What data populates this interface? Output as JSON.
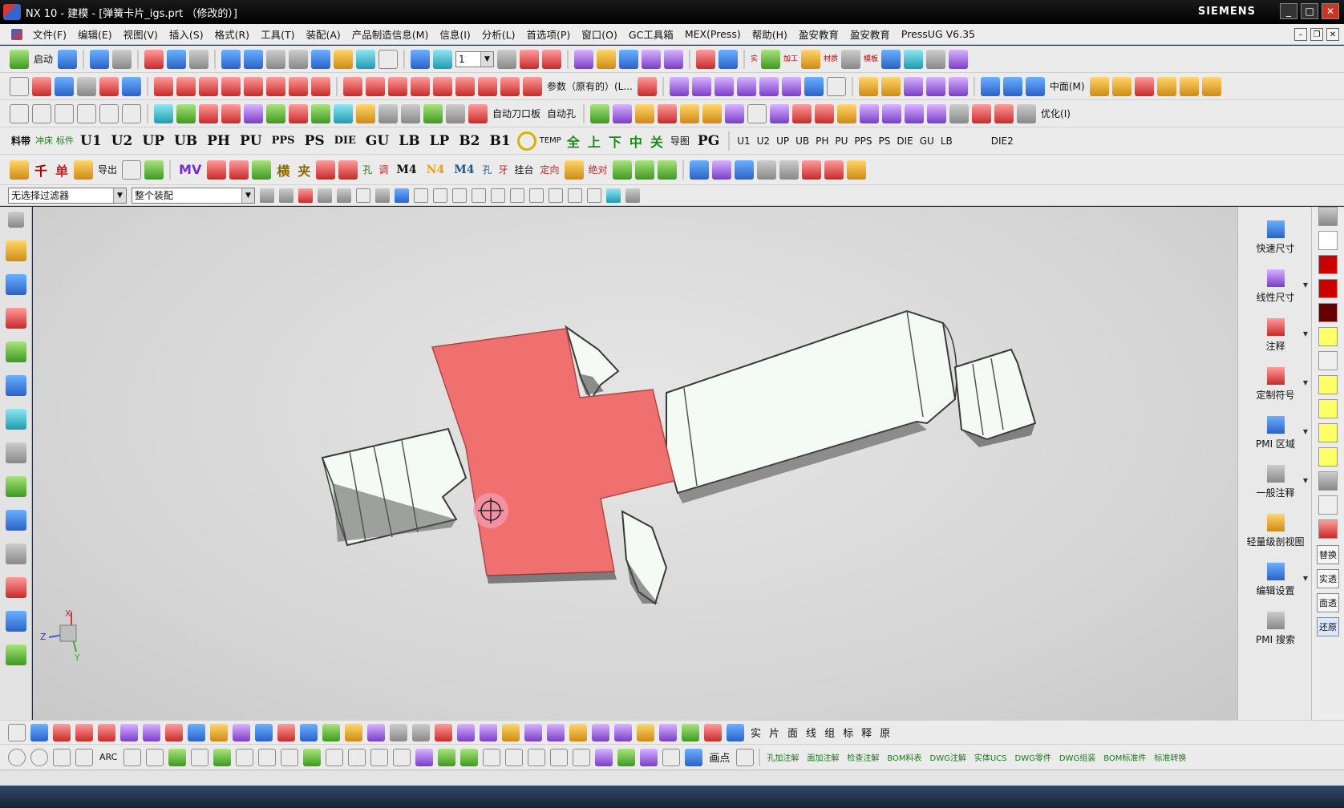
{
  "window": {
    "title": "NX 10 - 建模 - [弹簧卡片_igs.prt （修改的）]",
    "brand": "SIEMENS",
    "controls": [
      "_",
      "□",
      "✕"
    ]
  },
  "menu": [
    "文件(F)",
    "编辑(E)",
    "视图(V)",
    "插入(S)",
    "格式(R)",
    "工具(T)",
    "装配(A)",
    "产品制造信息(M)",
    "信息(I)",
    "分析(L)",
    "首选项(P)",
    "窗口(O)",
    "GC工具箱",
    "MEX(Press)",
    "帮助(H)",
    "盈安教育",
    "盈安教育",
    "PressUG V6.35"
  ],
  "toolbar1": {
    "start": "启动",
    "layer_value": "1",
    "right_labels": [
      "实",
      "加工",
      "材质",
      "模板"
    ]
  },
  "toolbar2": {
    "param_label": "参数（原有的）(L...",
    "middle_label": "中面(M)"
  },
  "toolbar3": {
    "labels": [
      "自动刀口板",
      "自动孔",
      "优化(I)"
    ]
  },
  "toolbar4": {
    "left": [
      "料带",
      "冲床",
      "标件"
    ],
    "codes": [
      "U1",
      "U2",
      "UP",
      "UB",
      "PH",
      "PU",
      "PPS",
      "PS",
      "DIE",
      "GU",
      "LB",
      "LP",
      "B2",
      "B1"
    ],
    "temp": "TEMP",
    "cn_labels": [
      "全",
      "上",
      "下",
      "中",
      "关"
    ],
    "map_label": "导图",
    "pg": "PG",
    "codes2": [
      "U1",
      "U2",
      "UP",
      "UB",
      "PH",
      "PU",
      "PPS",
      "PS",
      "DIE",
      "GU",
      "LB"
    ],
    "die2": "DIE2"
  },
  "toolbar5": {
    "labels": [
      "千",
      "单",
      "导出",
      "MV",
      "横",
      "夹",
      "M4",
      "N4",
      "M4",
      "孔",
      "调",
      "牙",
      "挂台",
      "定向",
      "绝对"
    ]
  },
  "filter": {
    "selection_filter": "无选择过滤器",
    "scope": "整个装配"
  },
  "pmi_panel": [
    "快速尺寸",
    "线性尺寸",
    "注释",
    "定制符号",
    "PMI 区域",
    "一般注释",
    "轻量级剖视图",
    "编辑设置",
    "PMI 搜索"
  ],
  "far_right": [
    "替换",
    "实透",
    "面透",
    "还原"
  ],
  "bottom1": {
    "labels": [
      "实",
      "片",
      "面",
      "线",
      "组",
      "标",
      "释",
      "原"
    ]
  },
  "bottom2": {
    "labels": [
      "ARC",
      "画点",
      "孔加注解",
      "面加注解",
      "检查注解",
      "BOM料表",
      "DWG注解",
      "实体UCS",
      "DWG零件",
      "DWG组装",
      "BOM标准件",
      "标准转换"
    ]
  },
  "viewport": {
    "part_colors": {
      "body": "#f4faf4",
      "edge": "#3a3a3a",
      "highlight": "#f07070"
    },
    "axis_labels": {
      "x": "X",
      "y": "Y",
      "z": "Z"
    }
  }
}
